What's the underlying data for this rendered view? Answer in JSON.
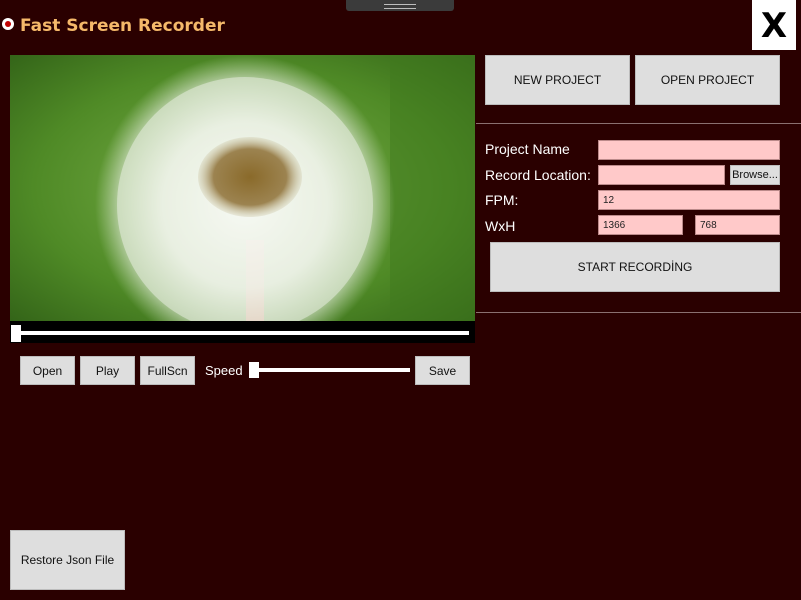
{
  "app": {
    "title": "Fast Screen Recorder",
    "close_label": "X"
  },
  "player": {
    "open_label": "Open",
    "play_label": "Play",
    "fullscreen_label": "FullScn",
    "speed_label": "Speed",
    "save_label": "Save",
    "seek_progress": 0,
    "speed_level": 0
  },
  "project": {
    "new_label": "NEW PROJECT",
    "open_label": "OPEN PROJECT"
  },
  "settings": {
    "project_name_label": "Project Name",
    "project_name_value": "",
    "record_location_label": "Record Location:",
    "record_location_value": "",
    "browse_label": "Browse...",
    "fpm_label": "FPM:",
    "fpm_value": "12",
    "wxh_label": "WxH",
    "width_value": "1366",
    "height_value": "768",
    "start_label": "START RECORDİNG"
  },
  "footer": {
    "restore_label": "Restore Json File"
  },
  "colors": {
    "background": "#2a0000",
    "title": "#f5b96a",
    "input_bg": "#ffc9c9",
    "button_bg": "#dedede"
  },
  "icons": {
    "record": "record-icon"
  }
}
